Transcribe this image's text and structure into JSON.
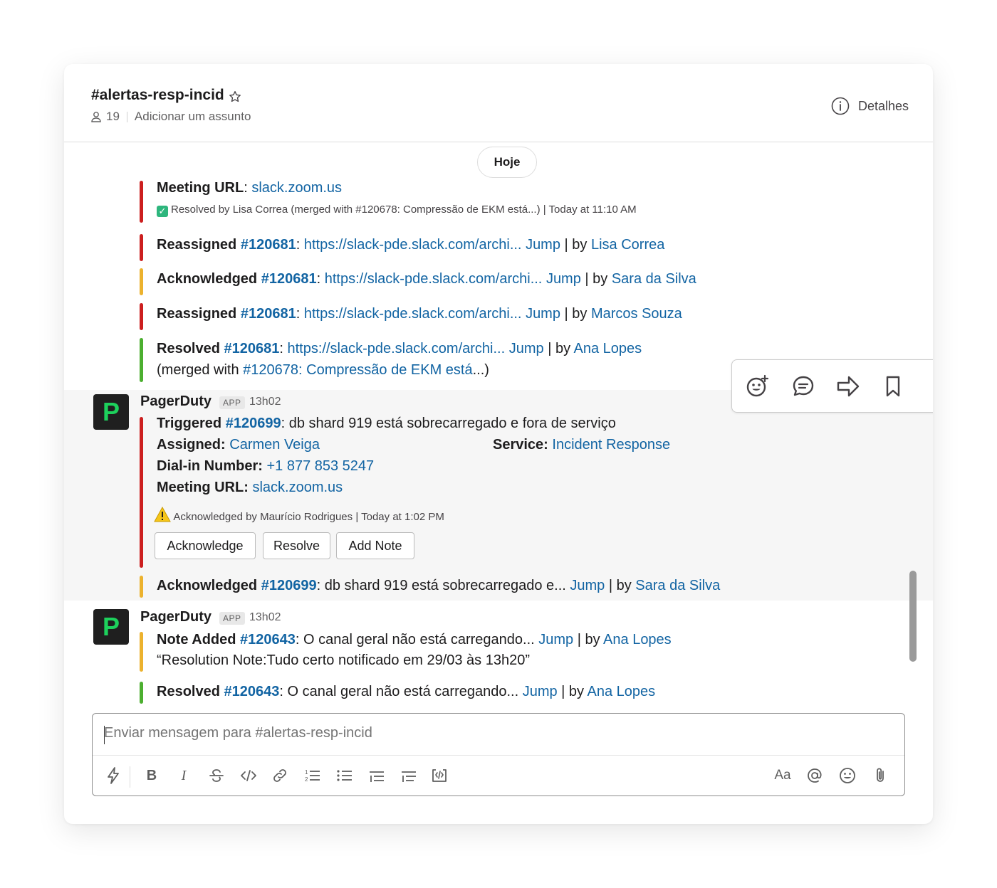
{
  "channel": {
    "name": "#alertas-resp-incid",
    "member_count": "19",
    "topic": "Adicionar um assunto",
    "details_label": "Detalhes"
  },
  "divider": {
    "label": "Hoje"
  },
  "top_message": {
    "meeting_label": "Meeting URL",
    "meeting_url": "slack.zoom.us",
    "resolved_note": "Resolved by Lisa Correa (merged with #120678: Compressão de EKM está...) | Today at 11:10 AM"
  },
  "events": [
    {
      "action": "Reassigned",
      "incident": "#120681",
      "url": "https://slack-pde.slack.com/archi...",
      "jump": "Jump",
      "by": "| by",
      "user": "Lisa Correa",
      "color": "#cc1f1f"
    },
    {
      "action": "Acknowledged",
      "incident": "#120681",
      "url": "https://slack-pde.slack.com/archi...",
      "jump": "Jump",
      "by": "| by",
      "user": "Sara da Silva",
      "color": "#ecb22e"
    },
    {
      "action": "Reassigned",
      "incident": "#120681",
      "url": "https://slack-pde.slack.com/archi...",
      "jump": "Jump",
      "by": "| by",
      "user": "Marcos Souza",
      "color": "#cc1f1f"
    },
    {
      "action": "Resolved",
      "incident": "#120681",
      "url": "https://slack-pde.slack.com/archi...",
      "jump": "Jump",
      "by": "| by",
      "user": "Ana Lopes",
      "color": "#4caf30",
      "merged_prefix": "(merged with",
      "merged_link": "#120678: Compressão de EKM está",
      "merged_suffix": "...)"
    }
  ],
  "pd_message_1": {
    "sender": "PagerDuty",
    "badge": "APP",
    "time": "13h02",
    "triggered_label": "Triggered",
    "incident": "#120699",
    "description": ": db shard 919 está sobrecarregado e fora de serviço",
    "assigned_label": "Assigned:",
    "assigned_user": "Carmen Veiga",
    "service_label": "Service:",
    "service_value": "Incident Response",
    "dial_label": "Dial-in Number:",
    "dial_value": "+1 877 853 5247",
    "meeting_label": "Meeting URL:",
    "meeting_url": "slack.zoom.us",
    "ack_note_by": "Acknowledged by Maurício Rodrigues",
    "ack_note_time": "| Today at 1:02 PM",
    "buttons": [
      "Acknowledge",
      "Resolve",
      "Add Note"
    ],
    "followup": {
      "action": "Acknowledged",
      "incident": "#120699",
      "text": ":  db shard 919 está sobrecarregado e...",
      "jump": "Jump",
      "by": "| by",
      "user": "Sara da Silva"
    }
  },
  "pd_message_2": {
    "sender": "PagerDuty",
    "badge": "APP",
    "time": "13h02",
    "note_action": "Note Added",
    "note_incident": "#120643",
    "note_text": ": O canal geral não está carregando...",
    "note_jump": "Jump",
    "note_by": "| by",
    "note_user": "Ana Lopes",
    "note_quote": "“Resolution Note:Tudo certo notificado em 29/03 às 13h20”",
    "resolved_action": "Resolved",
    "resolved_incident": "#120643",
    "resolved_text": ": O canal geral não está carregando...",
    "resolved_jump": "Jump",
    "resolved_by": "| by",
    "resolved_user": "Ana Lopes"
  },
  "composer": {
    "placeholder": "Enviar mensagem para #alertas-resp-incid",
    "text_size_label": "Aa"
  },
  "colors": {
    "link": "#1264a3",
    "red": "#cc1f1f",
    "yellow": "#ecb22e",
    "green": "#4caf30",
    "pagerduty": "#1dd15c"
  },
  "icons": {
    "header": [
      "star-icon",
      "person-icon",
      "info-icon"
    ],
    "message_actions": [
      "add-reaction-icon",
      "reply-thread-icon",
      "share-icon",
      "bookmark-icon"
    ],
    "composer": [
      "shortcuts-icon",
      "bold-icon",
      "italic-icon",
      "strikethrough-icon",
      "code-icon",
      "link-icon",
      "ordered-list-icon",
      "bulleted-list-icon",
      "blockquote-icon",
      "code-block-icon",
      "format-icon",
      "mention-icon",
      "emoji-icon",
      "attach-icon"
    ]
  }
}
